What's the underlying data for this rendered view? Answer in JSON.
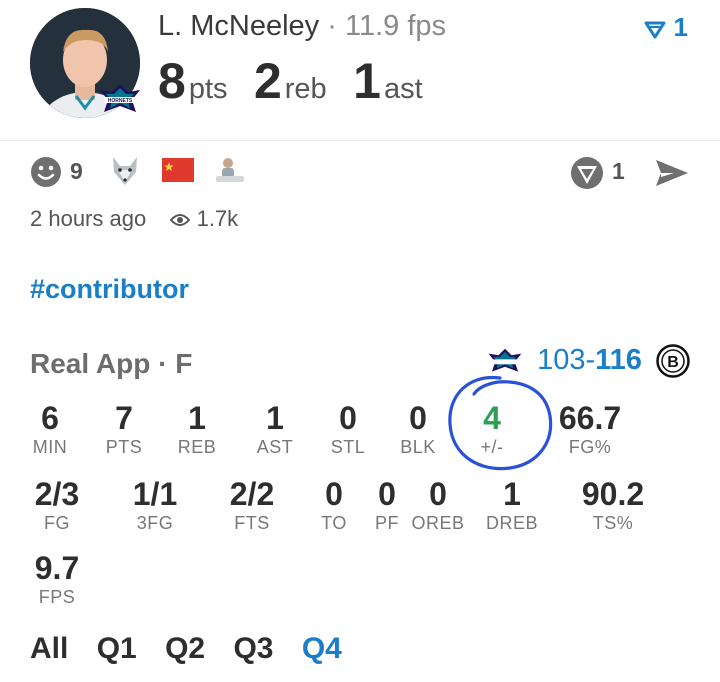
{
  "player": {
    "name": "L. McNeeley",
    "separator": "·",
    "fps": "11.9 fps",
    "pts_value": "8",
    "pts_label": "pts",
    "reb_value": "2",
    "reb_label": "reb",
    "ast_value": "1",
    "ast_label": "ast",
    "team_logo_text": "HORNETS"
  },
  "vote": {
    "count": "1",
    "icon": "chevron-vote-icon",
    "color": "#1a7fc8"
  },
  "actions": {
    "reaction_count": "9",
    "reaction_icon": "smiley-icon",
    "award_count": "1",
    "flag": "china-flag"
  },
  "meta": {
    "time": "2 hours ago",
    "views": "1.7k"
  },
  "tag": "#contributor",
  "box": {
    "title": "Real App · F",
    "score_left": "103",
    "score_dash": "-",
    "score_right": "116",
    "opponent_logo_text": "B"
  },
  "stats_row1": [
    {
      "value": "6",
      "label": "MIN"
    },
    {
      "value": "7",
      "label": "PTS"
    },
    {
      "value": "1",
      "label": "REB"
    },
    {
      "value": "1",
      "label": "AST"
    },
    {
      "value": "0",
      "label": "STL"
    },
    {
      "value": "0",
      "label": "BLK"
    },
    {
      "value": "4",
      "label": "+/-"
    },
    {
      "value": "66.7",
      "label": "FG%"
    }
  ],
  "stats_row2": [
    {
      "value": "2/3",
      "label": "FG"
    },
    {
      "value": "1/1",
      "label": "3FG"
    },
    {
      "value": "2/2",
      "label": "FTS"
    },
    {
      "value": "0",
      "label": "TO"
    },
    {
      "value": "0",
      "label": "PF"
    },
    {
      "value": "0",
      "label": "OREB"
    },
    {
      "value": "1",
      "label": "DREB"
    },
    {
      "value": "90.2",
      "label": "TS%"
    }
  ],
  "stats_row3": [
    {
      "value": "9.7",
      "label": "FPS"
    }
  ],
  "quarters": [
    "All",
    "Q1",
    "Q2",
    "Q3",
    "Q4"
  ],
  "active_quarter": "Q4",
  "colors": {
    "accent": "#1a7fc8",
    "plus_minus": "#2e9e57",
    "annotation": "#2a52d8"
  }
}
